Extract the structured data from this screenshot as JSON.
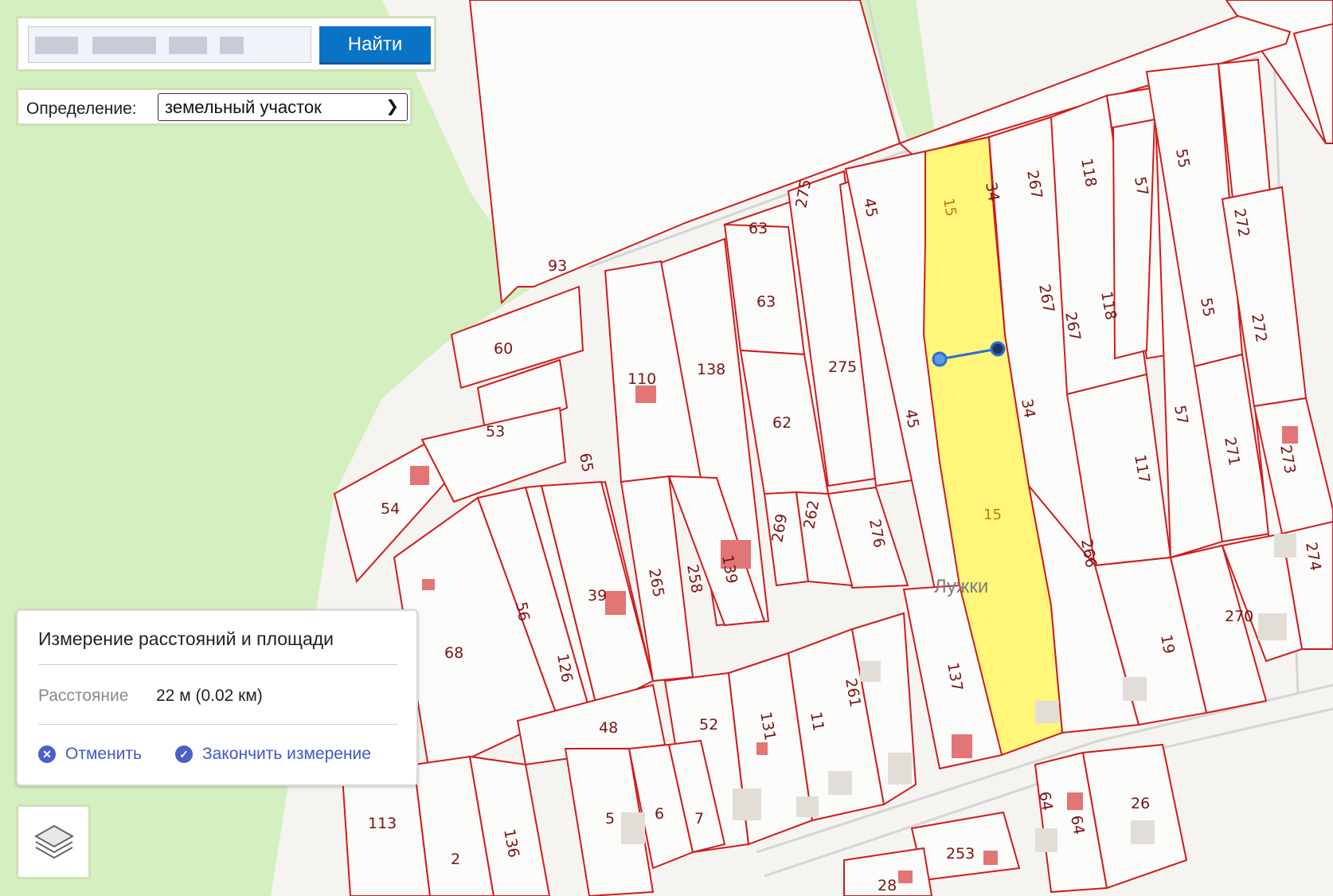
{
  "search": {
    "placeholder": "",
    "button_label": "Найти"
  },
  "definition": {
    "label": "Определение:",
    "selected": "земельный участок"
  },
  "measure": {
    "title": "Измерение расстояний и площади",
    "distance_label": "Расстояние",
    "distance_value": "22 м (0.02 км)",
    "cancel_label": "Отменить",
    "finish_label": "Закончить измерение"
  },
  "map": {
    "place_name": "Лужки",
    "plot_labels": [
      "15",
      "15",
      "34",
      "34",
      "267",
      "267",
      "267",
      "118",
      "118",
      "57",
      "57",
      "55",
      "55",
      "272",
      "272",
      "271",
      "273",
      "274",
      "270",
      "19",
      "117",
      "266",
      "45",
      "45",
      "275",
      "275",
      "63",
      "63",
      "62",
      "93",
      "60",
      "53",
      "54",
      "65",
      "110",
      "138",
      "276",
      "262",
      "269",
      "139",
      "258",
      "265",
      "39",
      "56",
      "126",
      "68",
      "48",
      "52",
      "131",
      "11",
      "261",
      "137",
      "5",
      "6",
      "7",
      "113",
      "2",
      "136",
      "64",
      "64",
      "26",
      "253",
      "28"
    ],
    "layers_icon": "layers-icon"
  },
  "colors": {
    "parcel_border": "#d01c1c",
    "selected_parcel": "#fff67a",
    "measure_line": "#2a6fd6",
    "accent_button": "#0a73c6",
    "forest": "#d4efc0"
  }
}
